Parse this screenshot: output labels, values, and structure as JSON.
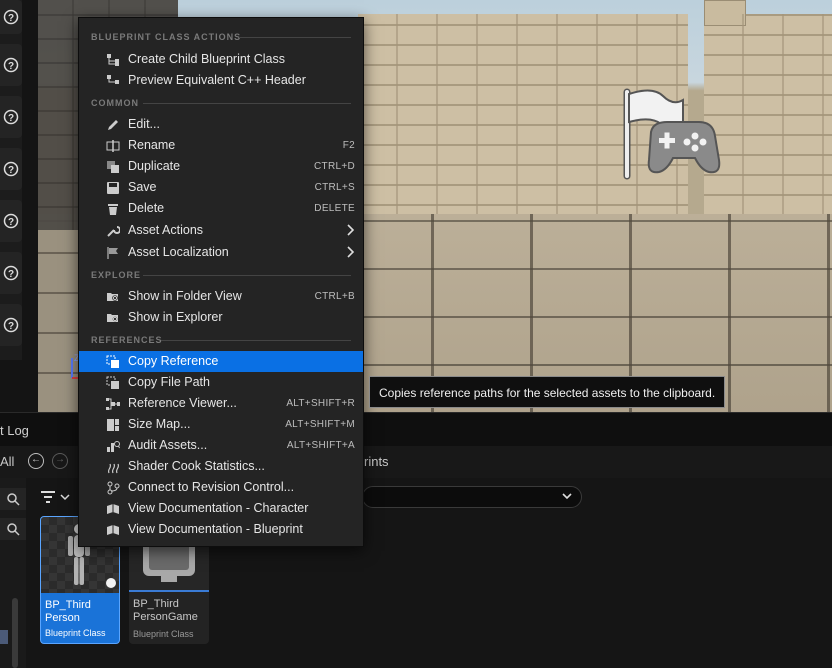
{
  "menu": {
    "sections": {
      "blueprint_class_actions": "BLUEPRINT CLASS ACTIONS",
      "common": "COMMON",
      "explore": "EXPLORE",
      "references": "REFERENCES"
    },
    "items": {
      "create_child": {
        "label": "Create Child Blueprint Class",
        "icon": "blueprint-hierarchy-icon"
      },
      "preview_cpp": {
        "label": "Preview Equivalent C++ Header",
        "icon": "cpp-header-icon"
      },
      "edit": {
        "label": "Edit...",
        "icon": "pencil-icon"
      },
      "rename": {
        "label": "Rename",
        "shortcut": "F2",
        "icon": "rename-icon"
      },
      "duplicate": {
        "label": "Duplicate",
        "shortcut": "CTRL+D",
        "icon": "duplicate-icon"
      },
      "save": {
        "label": "Save",
        "shortcut": "CTRL+S",
        "icon": "save-icon"
      },
      "delete": {
        "label": "Delete",
        "shortcut": "DELETE",
        "icon": "trash-icon"
      },
      "asset_actions": {
        "label": "Asset Actions",
        "icon": "wrench-icon"
      },
      "asset_localization": {
        "label": "Asset Localization",
        "icon": "flag-icon"
      },
      "show_folder": {
        "label": "Show in Folder View",
        "shortcut": "CTRL+B",
        "icon": "folder-search-icon"
      },
      "show_explorer": {
        "label": "Show in Explorer",
        "icon": "folder-search-icon"
      },
      "copy_reference": {
        "label": "Copy Reference",
        "icon": "copy-icon"
      },
      "copy_file_path": {
        "label": "Copy File Path",
        "icon": "copy-icon"
      },
      "reference_viewer": {
        "label": "Reference Viewer...",
        "shortcut": "ALT+SHIFT+R",
        "icon": "reference-viewer-icon"
      },
      "size_map": {
        "label": "Size Map...",
        "shortcut": "ALT+SHIFT+M",
        "icon": "size-map-icon"
      },
      "audit_assets": {
        "label": "Audit Assets...",
        "shortcut": "ALT+SHIFT+A",
        "icon": "audit-icon"
      },
      "shader_cook": {
        "label": "Shader Cook Statistics...",
        "icon": "shader-icon"
      },
      "connect_revision": {
        "label": "Connect to Revision Control...",
        "icon": "revision-control-icon"
      },
      "doc_character": {
        "label": "View Documentation - Character",
        "icon": "book-icon"
      },
      "doc_blueprint": {
        "label": "View Documentation - Blueprint",
        "icon": "book-icon"
      }
    },
    "highlighted": "Copy Reference"
  },
  "tooltip": {
    "text": "Copies reference paths for the selected assets to the clipboard."
  },
  "content_browser": {
    "tab_label": "t Log",
    "all_label": "All",
    "breadcrumb": "rints",
    "assets": [
      {
        "name": "BP_Third Person",
        "type": "Blueprint Class",
        "selected": true
      },
      {
        "name": "BP_Third PersonGame",
        "type": "Blueprint Class",
        "selected": false
      }
    ]
  },
  "colors": {
    "highlight": "#0a70e4",
    "menu_bg": "#242424",
    "selected_tile": "#1a73d8"
  }
}
